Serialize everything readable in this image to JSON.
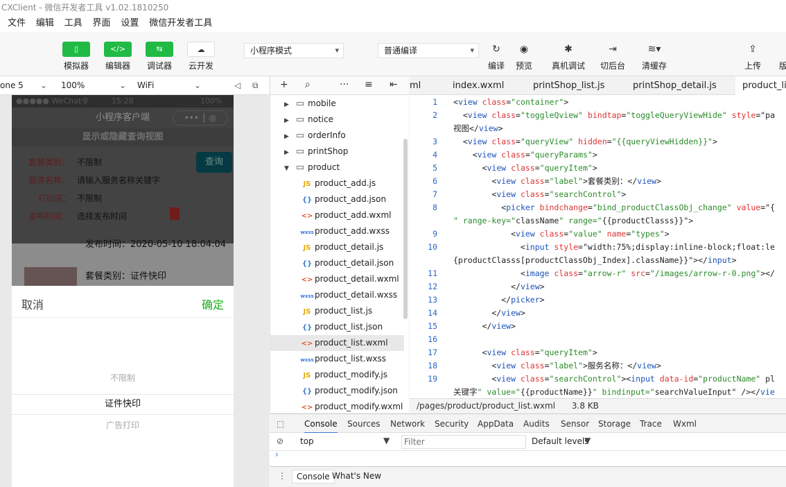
{
  "window": {
    "title": "CXClient - 微信开发者工具 v1.02.1810250"
  },
  "menu": [
    "文件",
    "编辑",
    "工具",
    "界面",
    "设置",
    "微信开发者工具"
  ],
  "toolbar": {
    "simulator": "模拟器",
    "editor": "编辑器",
    "debugger": "调试器",
    "cloud": "云开发",
    "mode": "小程序模式",
    "compile": "普通编译",
    "compile_btn": "编译",
    "preview": "预览",
    "remote_debug": "真机调试",
    "backstage": "切后台",
    "clear_cache": "清缓存",
    "upload": "上传",
    "version": "版"
  },
  "simbar": {
    "device": "one 5",
    "zoom": "100%",
    "network": "WiFi"
  },
  "phone": {
    "status_left": "●●●●● WeChat令",
    "status_time": "15:28",
    "status_right": "100%",
    "nav_title": "小程序客户端",
    "toggle": "显示或隐藏查询视图",
    "query_btn": "查询",
    "rows": [
      {
        "label": "套餐类别：",
        "value": "不限制"
      },
      {
        "label": "服务名称：",
        "value": "请输入服务名称关键字"
      },
      {
        "label": "打印店：",
        "value": "不限制"
      },
      {
        "label": "发布时间：",
        "value": "选择发布时间"
      }
    ],
    "list_time": "发布时间：2020-05-10 18:04:04",
    "list_cat": "套餐类别：证件快印",
    "picker": {
      "cancel": "取消",
      "confirm": "确定",
      "options": [
        "不限制",
        "证件快印",
        "广告打印"
      ]
    }
  },
  "filetree": {
    "items": [
      {
        "name": "mobile",
        "type": "folder",
        "open": false
      },
      {
        "name": "notice",
        "type": "folder",
        "open": false
      },
      {
        "name": "orderInfo",
        "type": "folder",
        "open": false
      },
      {
        "name": "printShop",
        "type": "folder",
        "open": false
      },
      {
        "name": "product",
        "type": "folder",
        "open": true
      },
      {
        "name": "product_add.js",
        "type": "js"
      },
      {
        "name": "product_add.json",
        "type": "json"
      },
      {
        "name": "product_add.wxml",
        "type": "wxml"
      },
      {
        "name": "product_add.wxss",
        "type": "wxss"
      },
      {
        "name": "product_detail.js",
        "type": "js"
      },
      {
        "name": "product_detail.json",
        "type": "json"
      },
      {
        "name": "product_detail.wxml",
        "type": "wxml"
      },
      {
        "name": "product_detail.wxss",
        "type": "wxss"
      },
      {
        "name": "product_list.js",
        "type": "js"
      },
      {
        "name": "product_list.json",
        "type": "json"
      },
      {
        "name": "product_list.wxml",
        "type": "wxml",
        "selected": true
      },
      {
        "name": "product_list.wxss",
        "type": "wxss"
      },
      {
        "name": "product_modify.js",
        "type": "js"
      },
      {
        "name": "product_modify.json",
        "type": "json"
      },
      {
        "name": "product_modify.wxml",
        "type": "wxml"
      }
    ]
  },
  "tabs": [
    "ml",
    "index.wxml",
    "printShop_list.js",
    "printShop_detail.js",
    "product_lis"
  ],
  "editor": {
    "lines": [
      {
        "n": "1",
        "code": "<view class=\"container\">"
      },
      {
        "n": "2",
        "code": "  <view class=\"toggleQview\" bindtap=\"toggleQueryViewHide\" style=\"pa"
      },
      {
        "n": "",
        "code": "视图</view>"
      },
      {
        "n": "3",
        "code": "  <view class=\"queryView\" hidden=\"{{queryViewHidden}}\">"
      },
      {
        "n": "4",
        "code": "    <view class=\"queryParams\">"
      },
      {
        "n": "5",
        "code": "      <view class=\"queryItem\">"
      },
      {
        "n": "6",
        "code": "        <view class=\"label\">套餐类别：</view>"
      },
      {
        "n": "7",
        "code": "        <view class=\"searchControl\">"
      },
      {
        "n": "8",
        "code": "          <picker bindchange=\"bind_productClassObj_change\" value=\"{"
      },
      {
        "n": "",
        "code": "\" range-key=\"className\" range=\"{{productClasss}}\">"
      },
      {
        "n": "9",
        "code": "            <view class=\"value\" name=\"types\">"
      },
      {
        "n": "10",
        "code": "              <input style=\"width:75%;display:inline-block;float:le"
      },
      {
        "n": "",
        "code": "{productClasss[productClassObj_Index].className}}\"></input>"
      },
      {
        "n": "11",
        "code": "              <image class=\"arrow-r\" src=\"/images/arrow-r-0.png\"></"
      },
      {
        "n": "12",
        "code": "            </view>"
      },
      {
        "n": "13",
        "code": "          </picker>"
      },
      {
        "n": "14",
        "code": "        </view>"
      },
      {
        "n": "15",
        "code": "      </view>"
      },
      {
        "n": "16",
        "code": ""
      },
      {
        "n": "17",
        "code": "      <view class=\"queryItem\">"
      },
      {
        "n": "18",
        "code": "        <view class=\"label\">服务名称：</view>"
      },
      {
        "n": "19",
        "code": "        <view class=\"searchControl\"><input data-id=\"productName\" pl"
      },
      {
        "n": "",
        "code": "关键字\" value=\"{{productName}}\" bindinput=\"searchValueInput\" /></vie"
      }
    ]
  },
  "statusfile": {
    "path": "/pages/product/product_list.wxml",
    "size": "3.8 KB"
  },
  "devtools": {
    "tabs": [
      "Console",
      "Sources",
      "Network",
      "Security",
      "AppData",
      "Audits",
      "Sensor",
      "Storage",
      "Trace",
      "Wxml"
    ],
    "context": "top",
    "filter_placeholder": "Filter",
    "levels": "Default levels",
    "drawer_tabs": [
      "Console",
      "What's New"
    ]
  }
}
